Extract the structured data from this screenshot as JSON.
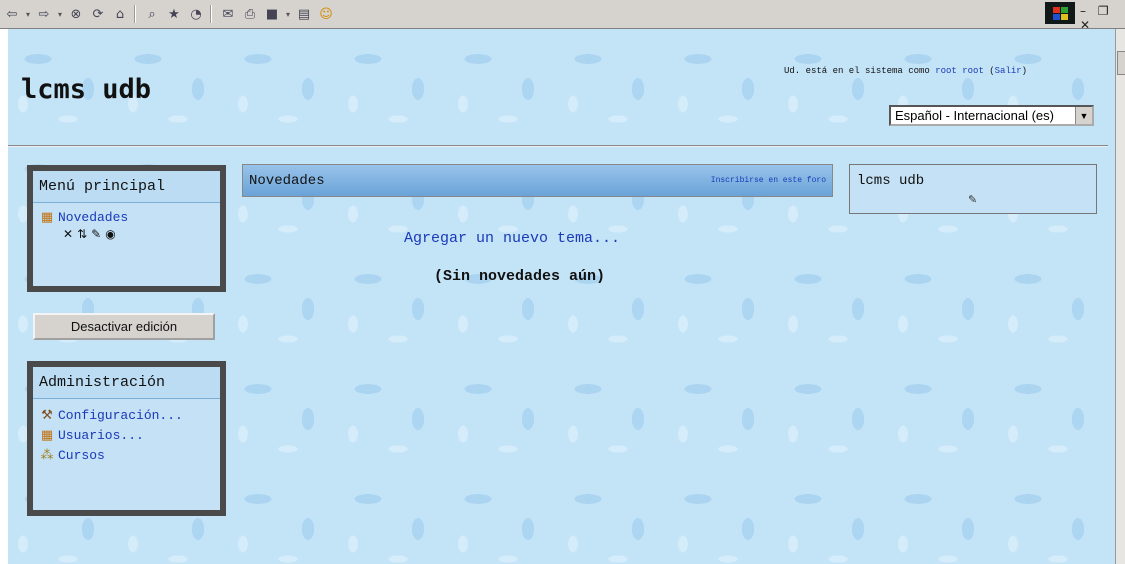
{
  "toolbar": {
    "buttons": [
      {
        "name": "back-icon",
        "glyph": "⇦"
      },
      {
        "name": "back-dropdown-icon",
        "glyph": "▾"
      },
      {
        "name": "forward-icon",
        "glyph": "⇨"
      },
      {
        "name": "forward-dropdown-icon",
        "glyph": "▾"
      },
      {
        "name": "stop-icon",
        "glyph": "⊗"
      },
      {
        "name": "refresh-icon",
        "glyph": "⟳"
      },
      {
        "name": "home-icon",
        "glyph": "⌂"
      },
      {
        "name": "search-icon",
        "glyph": "🔍"
      },
      {
        "name": "favorites-icon",
        "glyph": "★"
      },
      {
        "name": "history-icon",
        "glyph": "◔"
      },
      {
        "name": "mail-icon",
        "glyph": "✉"
      },
      {
        "name": "print-icon",
        "glyph": "⎙"
      },
      {
        "name": "edit-icon",
        "glyph": "■"
      },
      {
        "name": "discuss-icon",
        "glyph": "▤"
      },
      {
        "name": "messenger-icon",
        "glyph": "☺"
      }
    ]
  },
  "header": {
    "site_name": "lcms udb",
    "login_prefix": "Ud. está en el sistema como",
    "login_user": "root root",
    "logout_label": "Salir",
    "language": "Español - Internacional (es)"
  },
  "main_menu": {
    "title": "Menú principal",
    "item_label": "Novedades"
  },
  "edit_button": "Desactivar edición",
  "admin": {
    "title": "Administración",
    "items": [
      {
        "label": "Configuración...",
        "icon": "tools-icon"
      },
      {
        "label": "Usuarios...",
        "icon": "users-icon"
      },
      {
        "label": "Cursos",
        "icon": "courses-icon"
      }
    ]
  },
  "forum": {
    "title": "Novedades",
    "subscribe": "Inscribirse en este foro",
    "add_topic": "Agregar un nuevo tema...",
    "empty_message": "(Sin novedades aún)"
  },
  "right_block": {
    "title": "lcms udb"
  }
}
